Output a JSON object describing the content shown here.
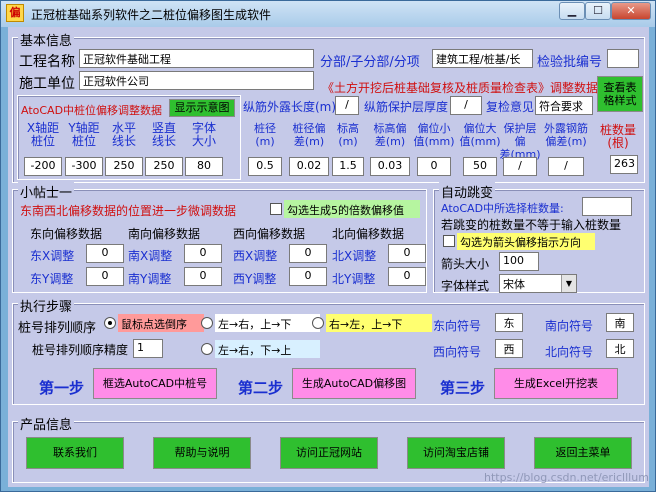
{
  "window": {
    "title": "正冠桩基础系列软件之二桩位偏移图生成软件",
    "icon_label": "偏"
  },
  "basic": {
    "legend": "基本信息",
    "project_name_label": "工程名称",
    "project_name_value": "正冠软件基础工程",
    "subproject_label": "分部/子分部/分项",
    "subproject_value": "建筑工程/桩基/长",
    "inspection_label": "检验批编号",
    "inspection_value": "",
    "construction_label": "施工单位",
    "construction_value": "正冠软件公司",
    "excel_note": "《土方开挖后桩基础复核及桩质量检查表》调整数据",
    "view_table_button": "查看表\n格样式",
    "autocad_label": "AtoCAD中桩位偏移调整数据",
    "show_diagram_button": "显示示意图",
    "rebar_exposed_label": "纵筋外露长度(m)",
    "rebar_exposed_value": "/",
    "rebar_cover_label": "纵筋保护层厚度",
    "rebar_cover_value": "/",
    "review_label": "复检意见",
    "review_value": "符合要求",
    "cad_headers": [
      "X轴距\n桩位",
      "Y轴距\n桩位",
      "水平\n线长",
      "竖直\n线长",
      "字体\n大小"
    ],
    "cad_values": [
      "-200",
      "-300",
      "250",
      "250",
      "80"
    ],
    "pile_headers": [
      "桩径\n(m)",
      "桩径偏\n差(m)",
      "标高\n(m)",
      "标高偏\n差(m)",
      "偏位小\n值(mm)",
      "偏位大\n值(mm)",
      "保护层偏\n差(mm)",
      "外露钢筋\n偏差(m)"
    ],
    "pile_values": [
      "0.5",
      "0.02",
      "1.5",
      "0.03",
      "0",
      "50",
      "/",
      "/"
    ],
    "pile_count_label": "桩数量\n(根)",
    "pile_count_value": "263"
  },
  "tips": {
    "legend": "小帖士一",
    "desc": "东南西北偏移数据的位置进一步微调数据",
    "multiple_checkbox": "勾选生成5的倍数偏移值",
    "groups": [
      {
        "title": "东向偏移数据",
        "x_label": "东X调整",
        "x_value": "0",
        "y_label": "东Y调整",
        "y_value": "0"
      },
      {
        "title": "南向偏移数据",
        "x_label": "南X调整",
        "x_value": "0",
        "y_label": "南Y调整",
        "y_value": "0"
      },
      {
        "title": "西向偏移数据",
        "x_label": "西X调整",
        "x_value": "0",
        "y_label": "西Y调整",
        "y_value": "0"
      },
      {
        "title": "北向偏移数据",
        "x_label": "北X调整",
        "x_value": "0",
        "y_label": "北Y调整",
        "y_value": "0"
      }
    ]
  },
  "jump": {
    "legend": "自动跳变",
    "selected_label": "AtoCAD中所选择桩数量:",
    "selected_value": "",
    "note": "若跳变的桩数量不等于输入桩数量",
    "arrow_checkbox": "勾选为箭头偏移指示方向",
    "arrow_size_label": "箭头大小",
    "arrow_size_value": "100",
    "font_style_label": "字体样式",
    "font_style_value": "宋体"
  },
  "steps": {
    "legend": "执行步骤",
    "order_label": "桩号排列顺序",
    "order_options": [
      "鼠标点选倒序",
      "左→右，上→下",
      "右→左，上→下",
      "左→右，下→上"
    ],
    "precision_label": "桩号排列顺序精度",
    "precision_value": "1",
    "east_label": "东向符号",
    "east_value": "东",
    "south_label": "南向符号",
    "south_value": "南",
    "west_label": "西向符号",
    "west_value": "西",
    "north_label": "北向符号",
    "north_value": "北",
    "step1_label": "第一步",
    "step1_button": "框选AutoCAD中桩号",
    "step2_label": "第二步",
    "step2_button": "生成AutoCAD偏移图",
    "step3_label": "第三步",
    "step3_button": "生成Excel开挖表"
  },
  "product": {
    "legend": "产品信息",
    "buttons": [
      "联系我们",
      "帮助与说明",
      "访问正冠网站",
      "访问淘宝店铺",
      "返回主菜单"
    ],
    "watermark": "https://blog.csdn.net/ericlllum"
  }
}
